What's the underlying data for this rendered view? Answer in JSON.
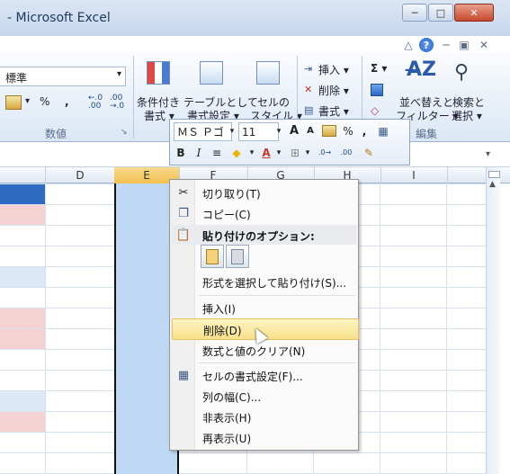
{
  "window": {
    "title": "- Microsoft Excel",
    "min_label": "─",
    "max_label": "□",
    "close_label": "✕"
  },
  "ribbon": {
    "number_format": "標準",
    "percent": "%",
    "comma": ",",
    "inc_decimal": "←.0\n.00",
    "dec_decimal": ".00\n→.0",
    "group_number": "数値",
    "cond_format_1": "条件付き",
    "cond_format_2": "書式 ▾",
    "table_format_1": "テーブルとして",
    "table_format_2": "書式設定 ▾",
    "cell_style_1": "セルの",
    "cell_style_2": "スタイル ▾",
    "insert": "挿入 ▾",
    "delete": "削除 ▾",
    "format": "書式 ▾",
    "sigma": "Σ ▾",
    "sort_1": "並べ替えと",
    "sort_2": "フィルター ▾",
    "find_1": "検索と",
    "find_2": "選択 ▾",
    "group_edit": "編集"
  },
  "mini_toolbar": {
    "font_name": "ＭＳ Ｐゴ",
    "font_size": "11",
    "bold": "B",
    "italic": "I",
    "percent": "%",
    "comma": ","
  },
  "columns": [
    "D",
    "E",
    "F",
    "G",
    "H",
    "I"
  ],
  "context_menu": {
    "items": [
      {
        "label": "切り取り(T)",
        "icon": "scissors-icon"
      },
      {
        "label": "コピー(C)",
        "icon": "copy-icon"
      },
      {
        "label": "貼り付けのオプション:",
        "icon": "paste-icon"
      },
      {
        "label": "形式を選択して貼り付け(S)..."
      },
      {
        "label": "挿入(I)"
      },
      {
        "label": "削除(D)"
      },
      {
        "label": "数式と値のクリア(N)"
      },
      {
        "label": "セルの書式設定(F)...",
        "icon": "format-cells-icon"
      },
      {
        "label": "列の幅(C)..."
      },
      {
        "label": "非表示(H)"
      },
      {
        "label": "再表示(U)"
      }
    ],
    "highlighted": "削除(D)"
  },
  "colors": {
    "selection": "#bfd9f5",
    "highlight": "#f7e089",
    "ribbon_bg": "#dbe7f5"
  }
}
